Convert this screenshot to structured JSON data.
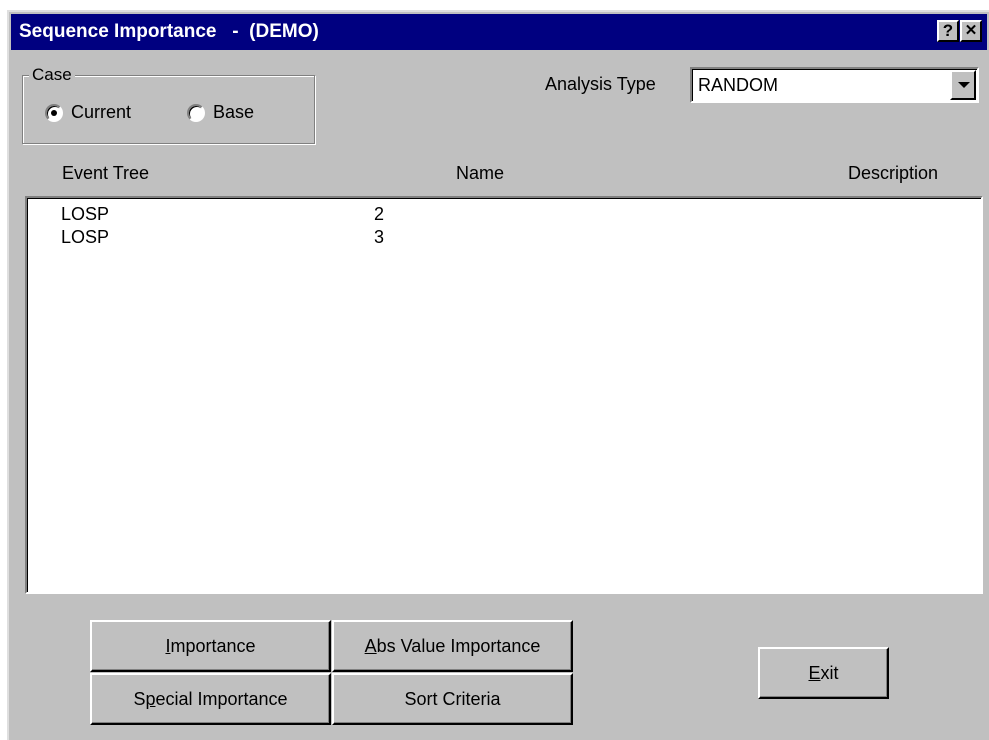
{
  "window": {
    "title": "Sequence Importance   -  (DEMO)",
    "help_label": "?",
    "close_label": "✕"
  },
  "case": {
    "legend": "Case",
    "options": [
      {
        "label": "Current",
        "checked": true
      },
      {
        "label": "Base",
        "checked": false
      }
    ]
  },
  "analysis": {
    "label": "Analysis Type",
    "value": "RANDOM"
  },
  "list": {
    "columns": [
      "Event Tree",
      "Name",
      "Description"
    ],
    "rows": [
      {
        "event_tree": "LOSP",
        "name": "2",
        "description": ""
      },
      {
        "event_tree": "LOSP",
        "name": "3",
        "description": ""
      }
    ]
  },
  "buttons": {
    "importance": {
      "mnemonic": "I",
      "rest": "mportance"
    },
    "abs_value_importance": {
      "mnemonic": "A",
      "rest": "bs Value Importance"
    },
    "special_importance": {
      "pre": "S",
      "mnemonic": "p",
      "rest": "ecial Importance"
    },
    "sort_criteria": {
      "label": "Sort Criteria"
    },
    "exit": {
      "mnemonic": "E",
      "rest": "xit"
    }
  }
}
